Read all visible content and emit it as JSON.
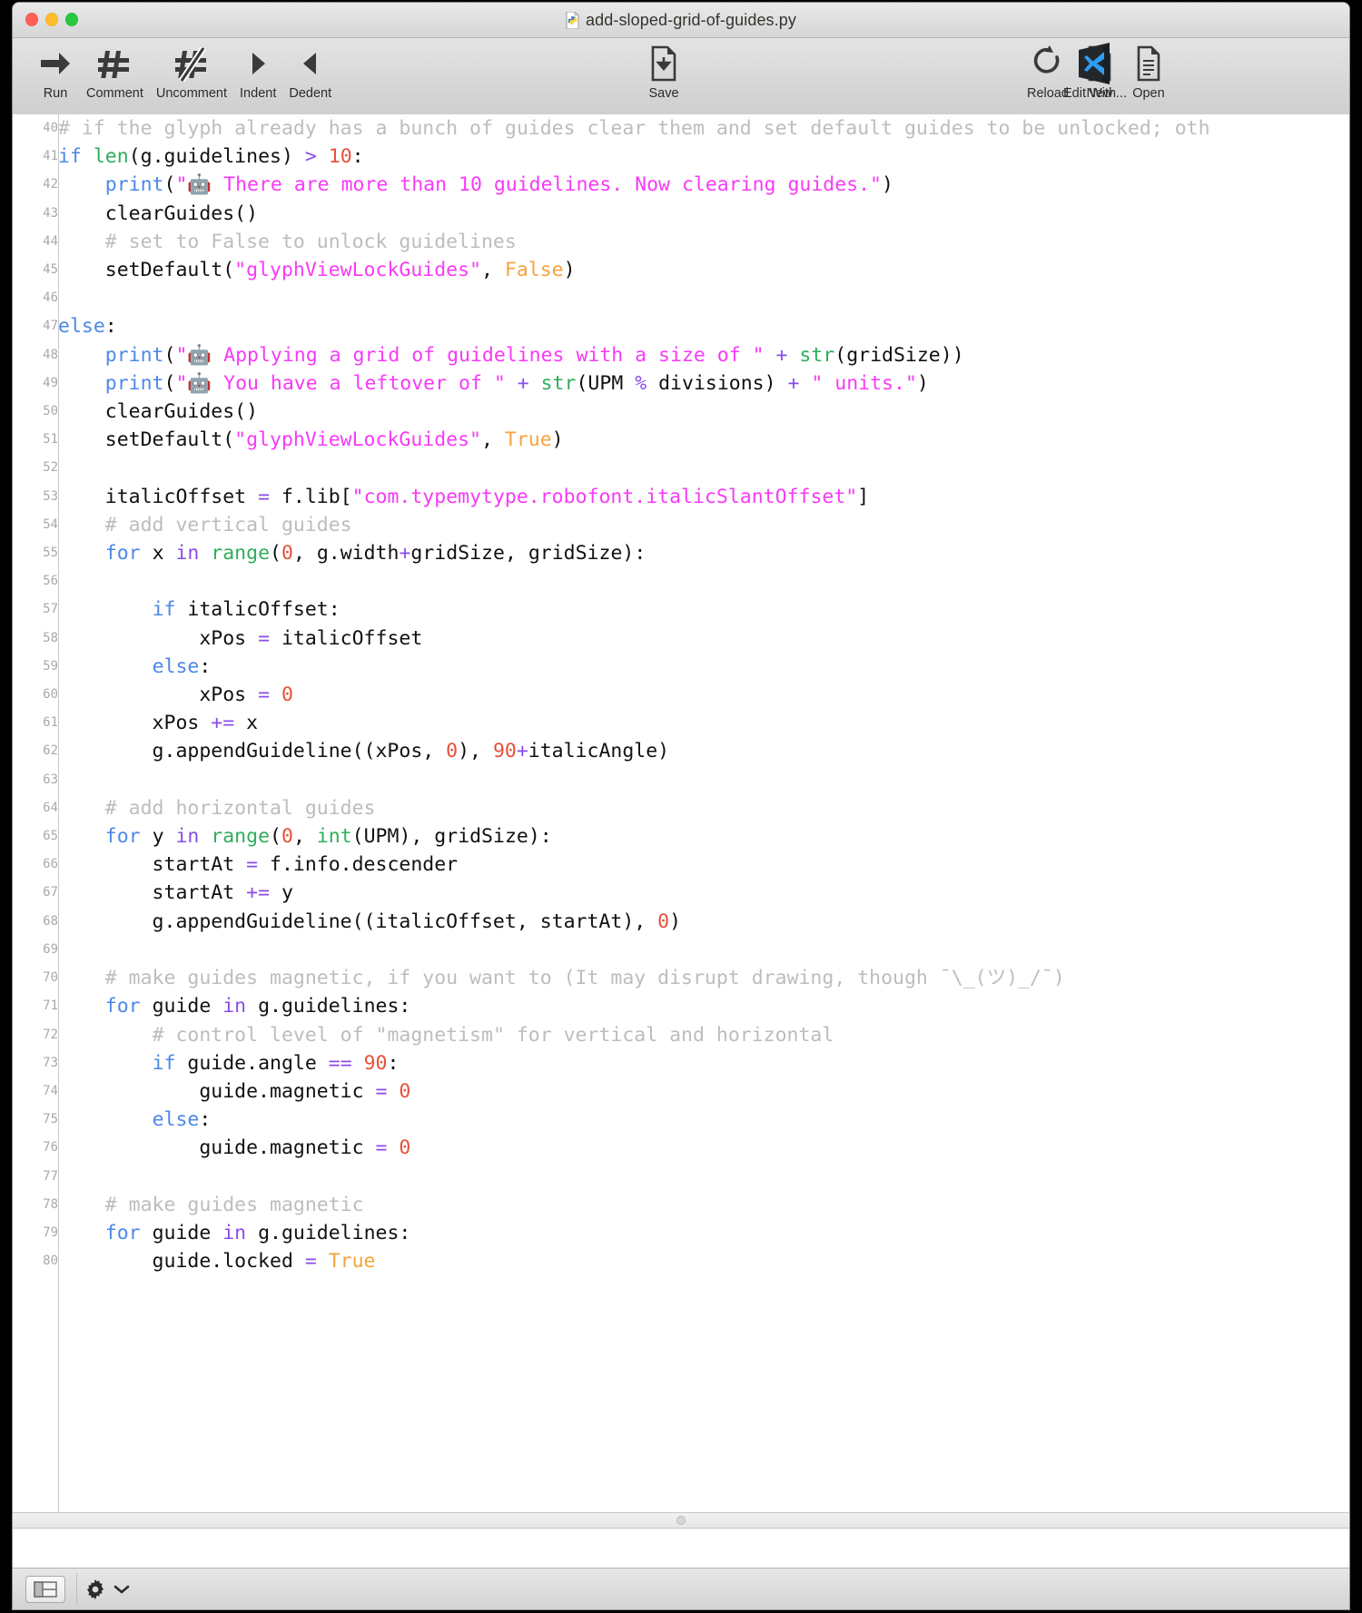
{
  "window": {
    "title": "add-sloped-grid-of-guides.py",
    "title_icon": "python-file-icon",
    "traffic_lights": [
      "close-button",
      "minimize-button",
      "zoom-button"
    ]
  },
  "toolbar": {
    "left_group": [
      {
        "label": "Run",
        "icon": "run-arrow-icon"
      },
      {
        "label": "Comment",
        "icon": "comment-hash-icon"
      },
      {
        "label": "Uncomment",
        "icon": "uncomment-hash-slash-icon"
      },
      {
        "label": "Indent",
        "icon": "indent-triangle-right-icon"
      },
      {
        "label": "Dedent",
        "icon": "dedent-triangle-left-icon"
      }
    ],
    "middle_group": [
      {
        "label": "Save",
        "icon": "save-document-icon"
      }
    ],
    "right_group": [
      {
        "label": "Reload",
        "icon": "reload-circular-arrow-icon"
      },
      {
        "label": "New",
        "icon": "new-document-icon"
      },
      {
        "label": "Open",
        "icon": "open-document-icon"
      }
    ],
    "external_group": [
      {
        "label": "Edit With...",
        "icon": "vscode-app-icon"
      }
    ]
  },
  "editor": {
    "first_line": 40,
    "last_line": 80,
    "lines": [
      {
        "n": "40",
        "tokens": [
          {
            "c": "t-com",
            "t": "# if the glyph already has a bunch of guides clear them and set default guides to be unlocked; oth"
          }
        ]
      },
      {
        "n": "41",
        "tokens": [
          {
            "c": "t-kw",
            "t": "if "
          },
          {
            "c": "t-bi",
            "t": "len"
          },
          {
            "c": "t-pl",
            "t": "(g.guidelines) "
          },
          {
            "c": "t-op",
            "t": "> "
          },
          {
            "c": "t-num",
            "t": "10"
          },
          {
            "c": "t-pl",
            "t": ":"
          }
        ]
      },
      {
        "n": "42",
        "tokens": [
          {
            "c": "t-pl",
            "t": "    "
          },
          {
            "c": "t-kw",
            "t": "print"
          },
          {
            "c": "t-pl",
            "t": "("
          },
          {
            "c": "t-str",
            "t": "\"🤖 There are more than 10 guidelines. Now clearing guides.\""
          },
          {
            "c": "t-pl",
            "t": ")"
          }
        ]
      },
      {
        "n": "43",
        "tokens": [
          {
            "c": "t-pl",
            "t": "    clearGuides()"
          }
        ]
      },
      {
        "n": "44",
        "tokens": [
          {
            "c": "t-pl",
            "t": "    "
          },
          {
            "c": "t-com",
            "t": "# set to False to unlock guidelines"
          }
        ]
      },
      {
        "n": "45",
        "tokens": [
          {
            "c": "t-pl",
            "t": "    setDefault("
          },
          {
            "c": "t-str",
            "t": "\"glyphViewLockGuides\""
          },
          {
            "c": "t-pl",
            "t": ", "
          },
          {
            "c": "t-const",
            "t": "False"
          },
          {
            "c": "t-pl",
            "t": ")"
          }
        ]
      },
      {
        "n": "46",
        "tokens": [
          {
            "c": "t-pl",
            "t": ""
          }
        ]
      },
      {
        "n": "47",
        "tokens": [
          {
            "c": "t-kw",
            "t": "else"
          },
          {
            "c": "t-pl",
            "t": ":"
          }
        ]
      },
      {
        "n": "48",
        "tokens": [
          {
            "c": "t-pl",
            "t": "    "
          },
          {
            "c": "t-kw",
            "t": "print"
          },
          {
            "c": "t-pl",
            "t": "("
          },
          {
            "c": "t-str",
            "t": "\"🤖 Applying a grid of guidelines with a size of \""
          },
          {
            "c": "t-pl",
            "t": " "
          },
          {
            "c": "t-op",
            "t": "+ "
          },
          {
            "c": "t-bi",
            "t": "str"
          },
          {
            "c": "t-pl",
            "t": "(gridSize))"
          }
        ]
      },
      {
        "n": "49",
        "tokens": [
          {
            "c": "t-pl",
            "t": "    "
          },
          {
            "c": "t-kw",
            "t": "print"
          },
          {
            "c": "t-pl",
            "t": "("
          },
          {
            "c": "t-str",
            "t": "\"🤖 You have a leftover of \""
          },
          {
            "c": "t-pl",
            "t": " "
          },
          {
            "c": "t-op",
            "t": "+ "
          },
          {
            "c": "t-bi",
            "t": "str"
          },
          {
            "c": "t-pl",
            "t": "(UPM "
          },
          {
            "c": "t-op",
            "t": "% "
          },
          {
            "c": "t-pl",
            "t": "divisions) "
          },
          {
            "c": "t-op",
            "t": "+ "
          },
          {
            "c": "t-str",
            "t": "\" units.\""
          },
          {
            "c": "t-pl",
            "t": ")"
          }
        ]
      },
      {
        "n": "50",
        "tokens": [
          {
            "c": "t-pl",
            "t": "    clearGuides()"
          }
        ]
      },
      {
        "n": "51",
        "tokens": [
          {
            "c": "t-pl",
            "t": "    setDefault("
          },
          {
            "c": "t-str",
            "t": "\"glyphViewLockGuides\""
          },
          {
            "c": "t-pl",
            "t": ", "
          },
          {
            "c": "t-const",
            "t": "True"
          },
          {
            "c": "t-pl",
            "t": ")"
          }
        ]
      },
      {
        "n": "52",
        "tokens": [
          {
            "c": "t-pl",
            "t": ""
          }
        ]
      },
      {
        "n": "53",
        "tokens": [
          {
            "c": "t-pl",
            "t": "    italicOffset "
          },
          {
            "c": "t-op",
            "t": "= "
          },
          {
            "c": "t-pl",
            "t": "f.lib["
          },
          {
            "c": "t-str",
            "t": "\"com.typemytype.robofont.italicSlantOffset\""
          },
          {
            "c": "t-pl",
            "t": "]"
          }
        ]
      },
      {
        "n": "54",
        "tokens": [
          {
            "c": "t-pl",
            "t": "    "
          },
          {
            "c": "t-com",
            "t": "# add vertical guides"
          }
        ]
      },
      {
        "n": "55",
        "tokens": [
          {
            "c": "t-pl",
            "t": "    "
          },
          {
            "c": "t-kw",
            "t": "for "
          },
          {
            "c": "t-pl",
            "t": "x "
          },
          {
            "c": "t-kw2",
            "t": "in "
          },
          {
            "c": "t-bi",
            "t": "range"
          },
          {
            "c": "t-pl",
            "t": "("
          },
          {
            "c": "t-num",
            "t": "0"
          },
          {
            "c": "t-pl",
            "t": ", g.width"
          },
          {
            "c": "t-op",
            "t": "+"
          },
          {
            "c": "t-pl",
            "t": "gridSize, gridSize):"
          }
        ]
      },
      {
        "n": "56",
        "tokens": [
          {
            "c": "t-pl",
            "t": ""
          }
        ]
      },
      {
        "n": "57",
        "tokens": [
          {
            "c": "t-pl",
            "t": "        "
          },
          {
            "c": "t-kw",
            "t": "if "
          },
          {
            "c": "t-pl",
            "t": "italicOffset:"
          }
        ]
      },
      {
        "n": "58",
        "tokens": [
          {
            "c": "t-pl",
            "t": "            xPos "
          },
          {
            "c": "t-op",
            "t": "= "
          },
          {
            "c": "t-pl",
            "t": "italicOffset"
          }
        ]
      },
      {
        "n": "59",
        "tokens": [
          {
            "c": "t-pl",
            "t": "        "
          },
          {
            "c": "t-kw",
            "t": "else"
          },
          {
            "c": "t-pl",
            "t": ":"
          }
        ]
      },
      {
        "n": "60",
        "tokens": [
          {
            "c": "t-pl",
            "t": "            xPos "
          },
          {
            "c": "t-op",
            "t": "= "
          },
          {
            "c": "t-num",
            "t": "0"
          }
        ]
      },
      {
        "n": "61",
        "tokens": [
          {
            "c": "t-pl",
            "t": "        xPos "
          },
          {
            "c": "t-op",
            "t": "+= "
          },
          {
            "c": "t-pl",
            "t": "x"
          }
        ]
      },
      {
        "n": "62",
        "tokens": [
          {
            "c": "t-pl",
            "t": "        g.appendGuideline((xPos, "
          },
          {
            "c": "t-num",
            "t": "0"
          },
          {
            "c": "t-pl",
            "t": "), "
          },
          {
            "c": "t-num",
            "t": "90"
          },
          {
            "c": "t-op",
            "t": "+"
          },
          {
            "c": "t-pl",
            "t": "italicAngle)"
          }
        ]
      },
      {
        "n": "63",
        "tokens": [
          {
            "c": "t-pl",
            "t": ""
          }
        ]
      },
      {
        "n": "64",
        "tokens": [
          {
            "c": "t-pl",
            "t": "    "
          },
          {
            "c": "t-com",
            "t": "# add horizontal guides"
          }
        ]
      },
      {
        "n": "65",
        "tokens": [
          {
            "c": "t-pl",
            "t": "    "
          },
          {
            "c": "t-kw",
            "t": "for "
          },
          {
            "c": "t-pl",
            "t": "y "
          },
          {
            "c": "t-kw2",
            "t": "in "
          },
          {
            "c": "t-bi",
            "t": "range"
          },
          {
            "c": "t-pl",
            "t": "("
          },
          {
            "c": "t-num",
            "t": "0"
          },
          {
            "c": "t-pl",
            "t": ", "
          },
          {
            "c": "t-bi",
            "t": "int"
          },
          {
            "c": "t-pl",
            "t": "(UPM), gridSize):"
          }
        ]
      },
      {
        "n": "66",
        "tokens": [
          {
            "c": "t-pl",
            "t": "        startAt "
          },
          {
            "c": "t-op",
            "t": "= "
          },
          {
            "c": "t-pl",
            "t": "f.info.descender"
          }
        ]
      },
      {
        "n": "67",
        "tokens": [
          {
            "c": "t-pl",
            "t": "        startAt "
          },
          {
            "c": "t-op",
            "t": "+= "
          },
          {
            "c": "t-pl",
            "t": "y"
          }
        ]
      },
      {
        "n": "68",
        "tokens": [
          {
            "c": "t-pl",
            "t": "        g.appendGuideline((italicOffset, startAt), "
          },
          {
            "c": "t-num",
            "t": "0"
          },
          {
            "c": "t-pl",
            "t": ")"
          }
        ]
      },
      {
        "n": "69",
        "tokens": [
          {
            "c": "t-pl",
            "t": ""
          }
        ]
      },
      {
        "n": "70",
        "tokens": [
          {
            "c": "t-pl",
            "t": "    "
          },
          {
            "c": "t-com",
            "t": "# make guides magnetic, if you want to (It may disrupt drawing, though ¯\\_(ツ)_/¯)"
          }
        ]
      },
      {
        "n": "71",
        "tokens": [
          {
            "c": "t-pl",
            "t": "    "
          },
          {
            "c": "t-kw",
            "t": "for "
          },
          {
            "c": "t-pl",
            "t": "guide "
          },
          {
            "c": "t-kw2",
            "t": "in "
          },
          {
            "c": "t-pl",
            "t": "g.guidelines:"
          }
        ]
      },
      {
        "n": "72",
        "tokens": [
          {
            "c": "t-pl",
            "t": "        "
          },
          {
            "c": "t-com",
            "t": "# control level of \"magnetism\" for vertical and horizontal"
          }
        ]
      },
      {
        "n": "73",
        "tokens": [
          {
            "c": "t-pl",
            "t": "        "
          },
          {
            "c": "t-kw",
            "t": "if "
          },
          {
            "c": "t-pl",
            "t": "guide.angle "
          },
          {
            "c": "t-op",
            "t": "== "
          },
          {
            "c": "t-num",
            "t": "90"
          },
          {
            "c": "t-pl",
            "t": ":"
          }
        ]
      },
      {
        "n": "74",
        "tokens": [
          {
            "c": "t-pl",
            "t": "            guide.magnetic "
          },
          {
            "c": "t-op",
            "t": "= "
          },
          {
            "c": "t-num",
            "t": "0"
          }
        ]
      },
      {
        "n": "75",
        "tokens": [
          {
            "c": "t-pl",
            "t": "        "
          },
          {
            "c": "t-kw",
            "t": "else"
          },
          {
            "c": "t-pl",
            "t": ":"
          }
        ]
      },
      {
        "n": "76",
        "tokens": [
          {
            "c": "t-pl",
            "t": "            guide.magnetic "
          },
          {
            "c": "t-op",
            "t": "= "
          },
          {
            "c": "t-num",
            "t": "0"
          }
        ]
      },
      {
        "n": "77",
        "tokens": [
          {
            "c": "t-pl",
            "t": ""
          }
        ]
      },
      {
        "n": "78",
        "tokens": [
          {
            "c": "t-pl",
            "t": "    "
          },
          {
            "c": "t-com",
            "t": "# make guides magnetic"
          }
        ]
      },
      {
        "n": "79",
        "tokens": [
          {
            "c": "t-pl",
            "t": "    "
          },
          {
            "c": "t-kw",
            "t": "for "
          },
          {
            "c": "t-pl",
            "t": "guide "
          },
          {
            "c": "t-kw2",
            "t": "in "
          },
          {
            "c": "t-pl",
            "t": "g.guidelines:"
          }
        ]
      },
      {
        "n": "80",
        "tokens": [
          {
            "c": "t-pl",
            "t": "        guide.locked "
          },
          {
            "c": "t-op",
            "t": "= "
          },
          {
            "c": "t-const",
            "t": "True"
          }
        ]
      }
    ]
  },
  "bottom_bar": {
    "split_view_icon": "split-view-toggle-icon",
    "gear_icon": "gear-icon",
    "chevron_icon": "chevron-down-icon"
  },
  "colors": {
    "comment": "#bdbdbd",
    "keyword": "#4d88e8",
    "keyword_alt": "#8b4ce8",
    "builtin": "#2fae5c",
    "string": "#f73af7",
    "number": "#e8503a",
    "constant": "#f5a43c",
    "plain": "#111111",
    "line_number": "#a9a9a9"
  }
}
